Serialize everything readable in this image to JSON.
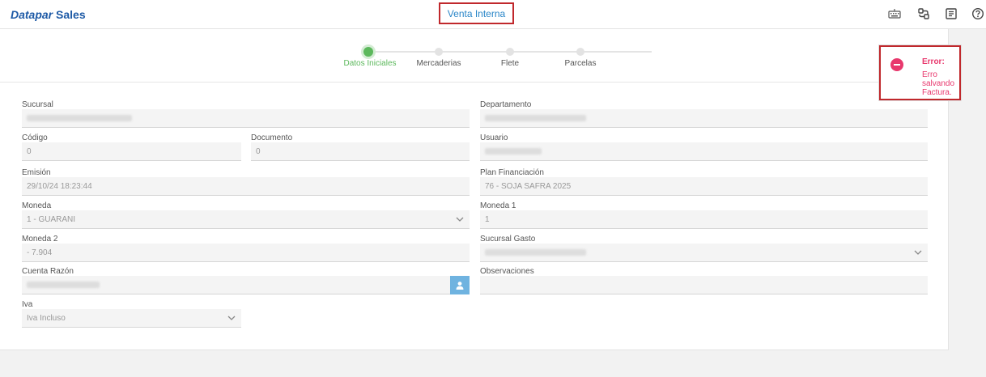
{
  "header": {
    "brand_part1": "Datapar",
    "brand_part2": "Sales",
    "center_title": "Venta Interna",
    "icons": [
      "keyboard-icon",
      "route-icon",
      "notes-icon",
      "help-icon"
    ]
  },
  "steps": [
    {
      "label": "Datos Iniciales",
      "active": true
    },
    {
      "label": "Mercaderias",
      "active": false
    },
    {
      "label": "Flete",
      "active": false
    },
    {
      "label": "Parcelas",
      "active": false
    }
  ],
  "form": {
    "sucursal": {
      "label": "Sucursal",
      "value": ""
    },
    "departamento": {
      "label": "Departamento",
      "value": ""
    },
    "codigo": {
      "label": "Código",
      "value": "0"
    },
    "documento": {
      "label": "Documento",
      "value": "0"
    },
    "usuario": {
      "label": "Usuario",
      "value": ""
    },
    "emision": {
      "label": "Emisión",
      "value": "29/10/24 18:23:44"
    },
    "plan": {
      "label": "Plan Financiación",
      "value": "76 - SOJA SAFRA 2025"
    },
    "moneda": {
      "label": "Moneda",
      "value": "1 - GUARANI"
    },
    "moneda1": {
      "label": "Moneda 1",
      "value": "1"
    },
    "moneda2": {
      "label": "Moneda 2",
      "value": "- 7.904"
    },
    "sucursal_gasto": {
      "label": "Sucursal Gasto",
      "value": ""
    },
    "cuenta_razon": {
      "label": "Cuenta Razón",
      "value": ""
    },
    "observaciones": {
      "label": "Observaciones",
      "value": ""
    },
    "iva": {
      "label": "Iva",
      "value": "Iva Incluso"
    }
  },
  "toast": {
    "title": "Error:",
    "message": "Erro salvando Factura."
  },
  "colors": {
    "brand": "#1e5aa6",
    "active_step": "#5cb85c",
    "error": "#e8386d",
    "highlight_border": "#c0282c",
    "user_button": "#6fb3e0"
  }
}
